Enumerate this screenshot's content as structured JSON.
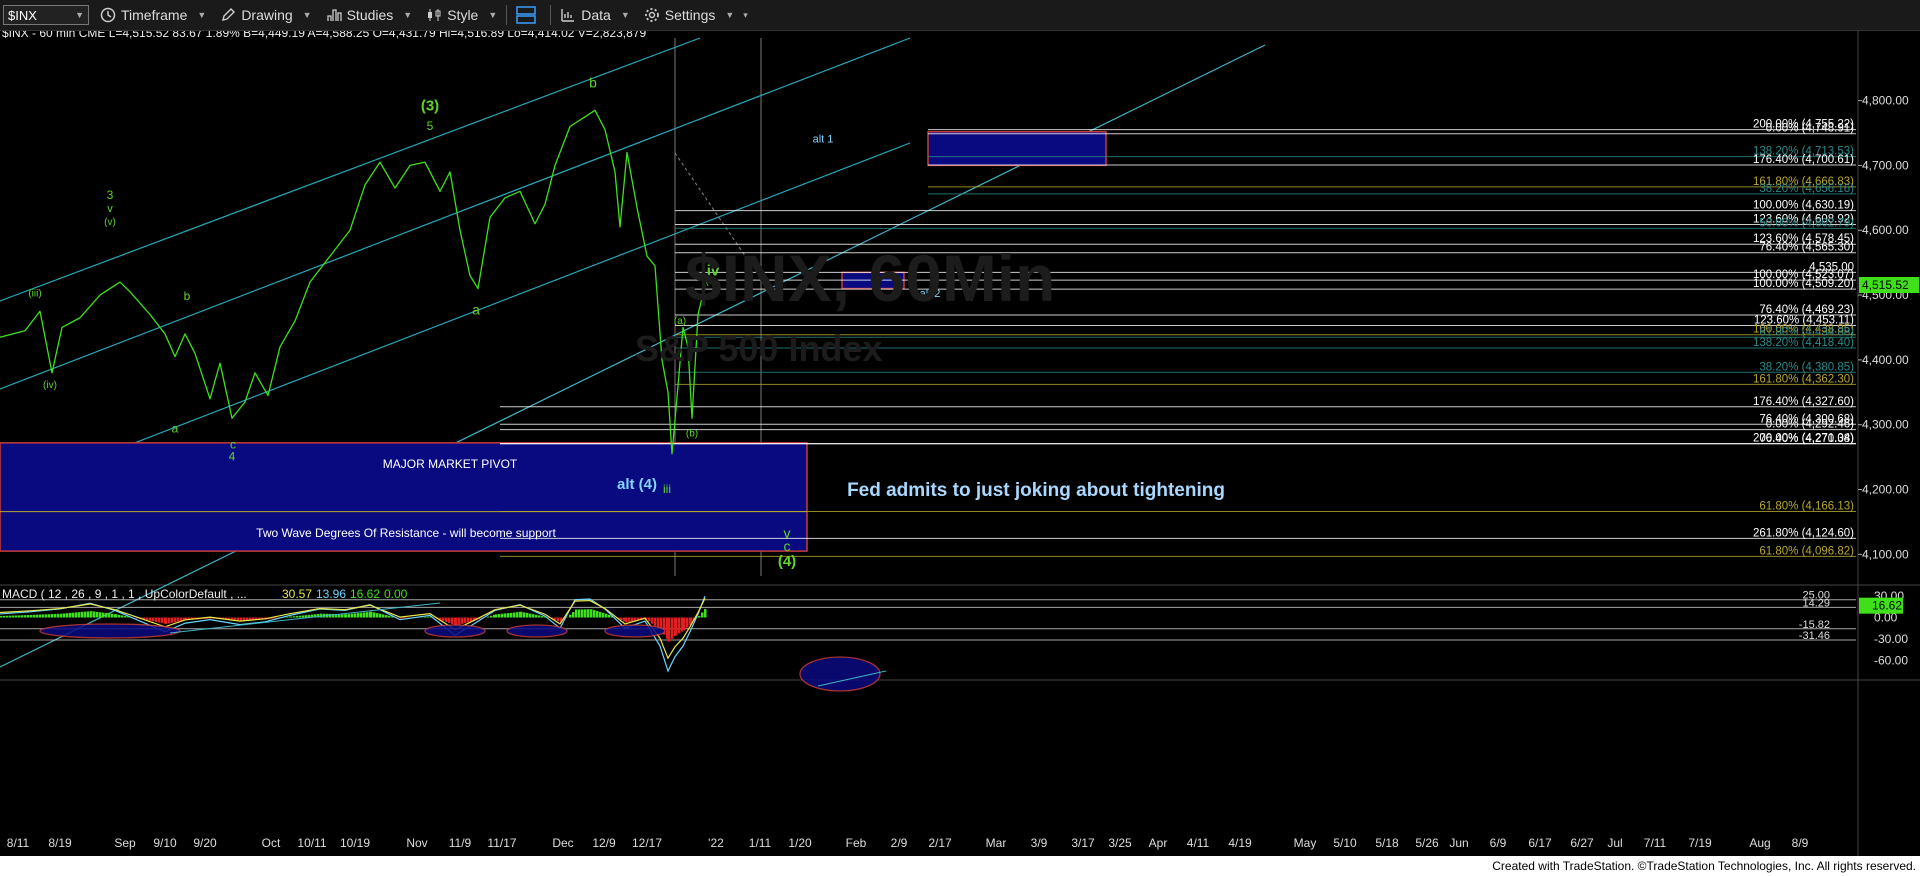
{
  "toolbar": {
    "symbol": "$INX",
    "timeframe": "Timeframe",
    "drawing": "Drawing",
    "studies": "Studies",
    "style": "Style",
    "data": "Data",
    "settings": "Settings"
  },
  "chart_data": {
    "type": "line",
    "header": "$INX - 60 min  CME  L=4,515.52  83.67  1.89%  B=4,449.19  A=4,588.25  O=4,431.79  Hi=4,516.89  Lo=4,414.02  V=2,823,879",
    "watermark_symbol": "$INX, 60Min",
    "watermark_name": "S&P 500 Index",
    "last_price": "4,515.52",
    "ylim": [
      4045,
      4895
    ],
    "yticks": [
      "4,800.00",
      "4,700.00",
      "4,600.00",
      "4,500.00",
      "4,400.00",
      "4,300.00",
      "4,200.00",
      "4,100.00"
    ],
    "ytick_values": [
      4800,
      4700,
      4600,
      4500,
      4400,
      4300,
      4200,
      4100
    ],
    "xticks": [
      "8/11",
      "8/19",
      "Sep",
      "9/10",
      "9/20",
      "Oct",
      "10/11",
      "10/19",
      "Nov",
      "11/9",
      "11/17",
      "Dec",
      "12/9",
      "12/17",
      "'22",
      "1/11",
      "1/20",
      "Feb",
      "2/9",
      "2/17",
      "Mar",
      "3/9",
      "3/17",
      "3/25",
      "Apr",
      "4/11",
      "4/19",
      "May",
      "5/10",
      "5/18",
      "5/26",
      "Jun",
      "6/9",
      "6/17",
      "6/27",
      "Jul",
      "7/11",
      "7/19",
      "Aug",
      "8/9"
    ],
    "price_series": [
      [
        0,
        4435
      ],
      [
        25,
        4445
      ],
      [
        40,
        4475
      ],
      [
        52,
        4380
      ],
      [
        62,
        4450
      ],
      [
        80,
        4465
      ],
      [
        100,
        4500
      ],
      [
        120,
        4520
      ],
      [
        130,
        4505
      ],
      [
        150,
        4470
      ],
      [
        165,
        4440
      ],
      [
        175,
        4405
      ],
      [
        185,
        4440
      ],
      [
        195,
        4410
      ],
      [
        210,
        4340
      ],
      [
        220,
        4395
      ],
      [
        232,
        4310
      ],
      [
        245,
        4335
      ],
      [
        255,
        4380
      ],
      [
        268,
        4345
      ],
      [
        280,
        4420
      ],
      [
        295,
        4460
      ],
      [
        310,
        4520
      ],
      [
        330,
        4560
      ],
      [
        350,
        4600
      ],
      [
        365,
        4670
      ],
      [
        380,
        4705
      ],
      [
        395,
        4665
      ],
      [
        410,
        4700
      ],
      [
        425,
        4705
      ],
      [
        440,
        4660
      ],
      [
        450,
        4690
      ],
      [
        460,
        4600
      ],
      [
        470,
        4530
      ],
      [
        478,
        4510
      ],
      [
        490,
        4620
      ],
      [
        505,
        4650
      ],
      [
        520,
        4660
      ],
      [
        535,
        4610
      ],
      [
        545,
        4640
      ],
      [
        555,
        4700
      ],
      [
        570,
        4760
      ],
      [
        585,
        4775
      ],
      [
        595,
        4785
      ],
      [
        605,
        4755
      ],
      [
        615,
        4690
      ],
      [
        620,
        4605
      ],
      [
        627,
        4720
      ],
      [
        637,
        4635
      ],
      [
        647,
        4560
      ],
      [
        655,
        4545
      ],
      [
        662,
        4400
      ],
      [
        668,
        4350
      ],
      [
        672,
        4255
      ],
      [
        678,
        4360
      ],
      [
        683,
        4450
      ],
      [
        688,
        4420
      ],
      [
        692,
        4310
      ],
      [
        698,
        4470
      ],
      [
        705,
        4515
      ]
    ],
    "macd_label": "MACD ( 12 , 26 , 9 , 1 , 1 , UpColorDefault , ...",
    "macd_values": [
      "30.57",
      "13.96",
      "16.62",
      "0.00"
    ],
    "macd_ylim": [
      -75,
      40
    ],
    "macd_yticks": [
      "30.00",
      "0.00",
      "-30.00",
      "-60.00"
    ],
    "macd_ytick_values": [
      30,
      0,
      -30,
      -60
    ],
    "macd_levels": [
      "25.00",
      "14.29",
      "-15.82",
      "-31.46"
    ],
    "macd_level_values": [
      25,
      14.29,
      -15.82,
      -31.46
    ],
    "macd_last": "16.62",
    "macd_series": [
      [
        0,
        5
      ],
      [
        30,
        8
      ],
      [
        60,
        12
      ],
      [
        90,
        20
      ],
      [
        115,
        10
      ],
      [
        140,
        -5
      ],
      [
        165,
        -20
      ],
      [
        185,
        -8
      ],
      [
        210,
        -3
      ],
      [
        240,
        -10
      ],
      [
        265,
        -6
      ],
      [
        290,
        3
      ],
      [
        320,
        12
      ],
      [
        345,
        10
      ],
      [
        370,
        18
      ],
      [
        400,
        -3
      ],
      [
        430,
        3
      ],
      [
        455,
        -25
      ],
      [
        475,
        -8
      ],
      [
        495,
        10
      ],
      [
        520,
        18
      ],
      [
        545,
        2
      ],
      [
        560,
        -15
      ],
      [
        575,
        25
      ],
      [
        590,
        26
      ],
      [
        605,
        12
      ],
      [
        625,
        -15
      ],
      [
        645,
        -5
      ],
      [
        660,
        -40
      ],
      [
        668,
        -75
      ],
      [
        675,
        -55
      ],
      [
        683,
        -40
      ],
      [
        690,
        -20
      ],
      [
        698,
        5
      ],
      [
        705,
        30
      ]
    ],
    "fib_levels": [
      {
        "label": "200.00% (4,755.22)",
        "value": 4755.22,
        "color": "#ffffff"
      },
      {
        "label": "0.00% (4,748.91)",
        "value": 4748.91,
        "color": "#ffffff"
      },
      {
        "label": "138.20% (4,713.53)",
        "value": 4713.53,
        "color": "#2a8a8a"
      },
      {
        "label": "176.40% (4,700.61)",
        "value": 4700.61,
        "color": "#ffffff"
      },
      {
        "label": "161.80% (4,666.83)",
        "value": 4666.83,
        "color": "#b8a830"
      },
      {
        "label": "38.20% (4,656.16)",
        "value": 4656.16,
        "color": "#2a8a8a"
      },
      {
        "label": "100.00% (4,630.19)",
        "value": 4630.19,
        "color": "#ffffff"
      },
      {
        "label": "123.60% (4,608.92)",
        "value": 4608.92,
        "color": "#ffffff"
      },
      {
        "label": "50.00% (4,602.79)",
        "value": 4602.79,
        "color": "#2a8a8a"
      },
      {
        "label": "123.60% (4,578.45)",
        "value": 4578.45,
        "color": "#ffffff"
      },
      {
        "label": "76.40% (4,565.30)",
        "value": 4565.3,
        "color": "#ffffff"
      },
      {
        "label": "4,535.00",
        "value": 4535.0,
        "color": "#ffffff"
      },
      {
        "label": "100.00% (4,523.07)",
        "value": 4523.07,
        "color": "#ffffff"
      },
      {
        "label": "100.00% (4,509.20)",
        "value": 4509.2,
        "color": "#ffffff"
      },
      {
        "label": "76.40% (4,469.23)",
        "value": 4469.23,
        "color": "#ffffff"
      },
      {
        "label": "123.60% (4,453.11)",
        "value": 4453.11,
        "color": "#ffffff"
      },
      {
        "label": "100.00% (4,438.85)",
        "value": 4438.85,
        "color": "#b8a830"
      },
      {
        "label": "61.80% (4,434.88)",
        "value": 4434.88,
        "color": "#2a8a8a"
      },
      {
        "label": "138.20% (4,418.40)",
        "value": 4418.4,
        "color": "#2a8a8a"
      },
      {
        "label": "38.20% (4,380.85)",
        "value": 4380.85,
        "color": "#2a8a8a"
      },
      {
        "label": "161.80% (4,362.30)",
        "value": 4362.3,
        "color": "#b8a830"
      },
      {
        "label": "176.40% (4,327.60)",
        "value": 4327.6,
        "color": "#ffffff"
      },
      {
        "label": "76.40% (4,300.68)",
        "value": 4300.68,
        "color": "#ffffff"
      },
      {
        "label": "0.00% (4,292.46)",
        "value": 4292.46,
        "color": "#ffffff"
      },
      {
        "label": "200.00% (4,271.04)",
        "value": 4271.04,
        "color": "#ffffff"
      },
      {
        "label": "76.40% (4,270.38)",
        "value": 4270.38,
        "color": "#ffffff"
      },
      {
        "label": "61.80% (4,166.13)",
        "value": 4166.13,
        "color": "#b8a830"
      },
      {
        "label": "261.80% (4,124.60)",
        "value": 4124.6,
        "color": "#ffffff"
      },
      {
        "label": "61.80% (4,096.82)",
        "value": 4096.82,
        "color": "#b8a830"
      }
    ],
    "wave_labels": [
      {
        "text": "(3)",
        "x": 430,
        "y": 4785,
        "size": 15,
        "bold": true
      },
      {
        "text": "5",
        "x": 430,
        "y": 4755,
        "size": 12
      },
      {
        "text": "3",
        "x": 110,
        "y": 4648,
        "size": 12
      },
      {
        "text": "v",
        "x": 110,
        "y": 4628,
        "size": 11
      },
      {
        "text": "(v)",
        "x": 110,
        "y": 4608,
        "size": 10
      },
      {
        "text": "(iii)",
        "x": 35,
        "y": 4498,
        "size": 10
      },
      {
        "text": "(iv)",
        "x": 50,
        "y": 4357,
        "size": 10
      },
      {
        "text": "b",
        "x": 187,
        "y": 4492,
        "size": 12
      },
      {
        "text": "a",
        "x": 175,
        "y": 4288,
        "size": 12
      },
      {
        "text": "c",
        "x": 233,
        "y": 4263,
        "size": 12
      },
      {
        "text": "4",
        "x": 232,
        "y": 4245,
        "size": 12
      },
      {
        "text": "a",
        "x": 476,
        "y": 4470,
        "size": 14
      },
      {
        "text": "b",
        "x": 593,
        "y": 4820,
        "size": 14
      },
      {
        "text": "iv",
        "x": 713,
        "y": 4530,
        "size": 15,
        "bold": true
      },
      {
        "text": "(c)",
        "x": 711,
        "y": 4517,
        "size": 9
      },
      {
        "text": "(a)",
        "x": 680,
        "y": 4455,
        "size": 10
      },
      {
        "text": "(b)",
        "x": 692,
        "y": 4282,
        "size": 10
      },
      {
        "text": "iii",
        "x": 667,
        "y": 4195,
        "size": 12
      },
      {
        "text": "v",
        "x": 787,
        "y": 4125,
        "size": 14
      },
      {
        "text": "c",
        "x": 787,
        "y": 4105,
        "size": 14
      },
      {
        "text": "(4)",
        "x": 787,
        "y": 4082,
        "size": 15,
        "bold": true
      }
    ],
    "annotations": [
      {
        "text": "alt 1",
        "x": 823,
        "y": 4735,
        "size": 11,
        "color": "#7fd7ff"
      },
      {
        "text": "alt 2",
        "x": 930,
        "y": 4497,
        "size": 11,
        "color": "#7fd7ff"
      },
      {
        "text": "alt (4)",
        "x": 637,
        "y": 4201,
        "size": 15,
        "color": "#7fd7ff",
        "bold": true
      },
      {
        "text": "MAJOR MARKET PIVOT",
        "x": 450,
        "y": 4233,
        "size": 12,
        "color": "#ffffff"
      },
      {
        "text": "Two Wave Degrees Of Resistance - will become support",
        "x": 406,
        "y": 4127,
        "size": 12,
        "color": "#ffffff"
      },
      {
        "text": "Fed admits to just joking about tightening",
        "x": 1036,
        "y": 4190,
        "size": 19,
        "color": "#a8d8ff",
        "bold": true
      }
    ]
  },
  "footer": "Created with TradeStation. ©TradeStation Technologies, Inc. All rights reserved."
}
